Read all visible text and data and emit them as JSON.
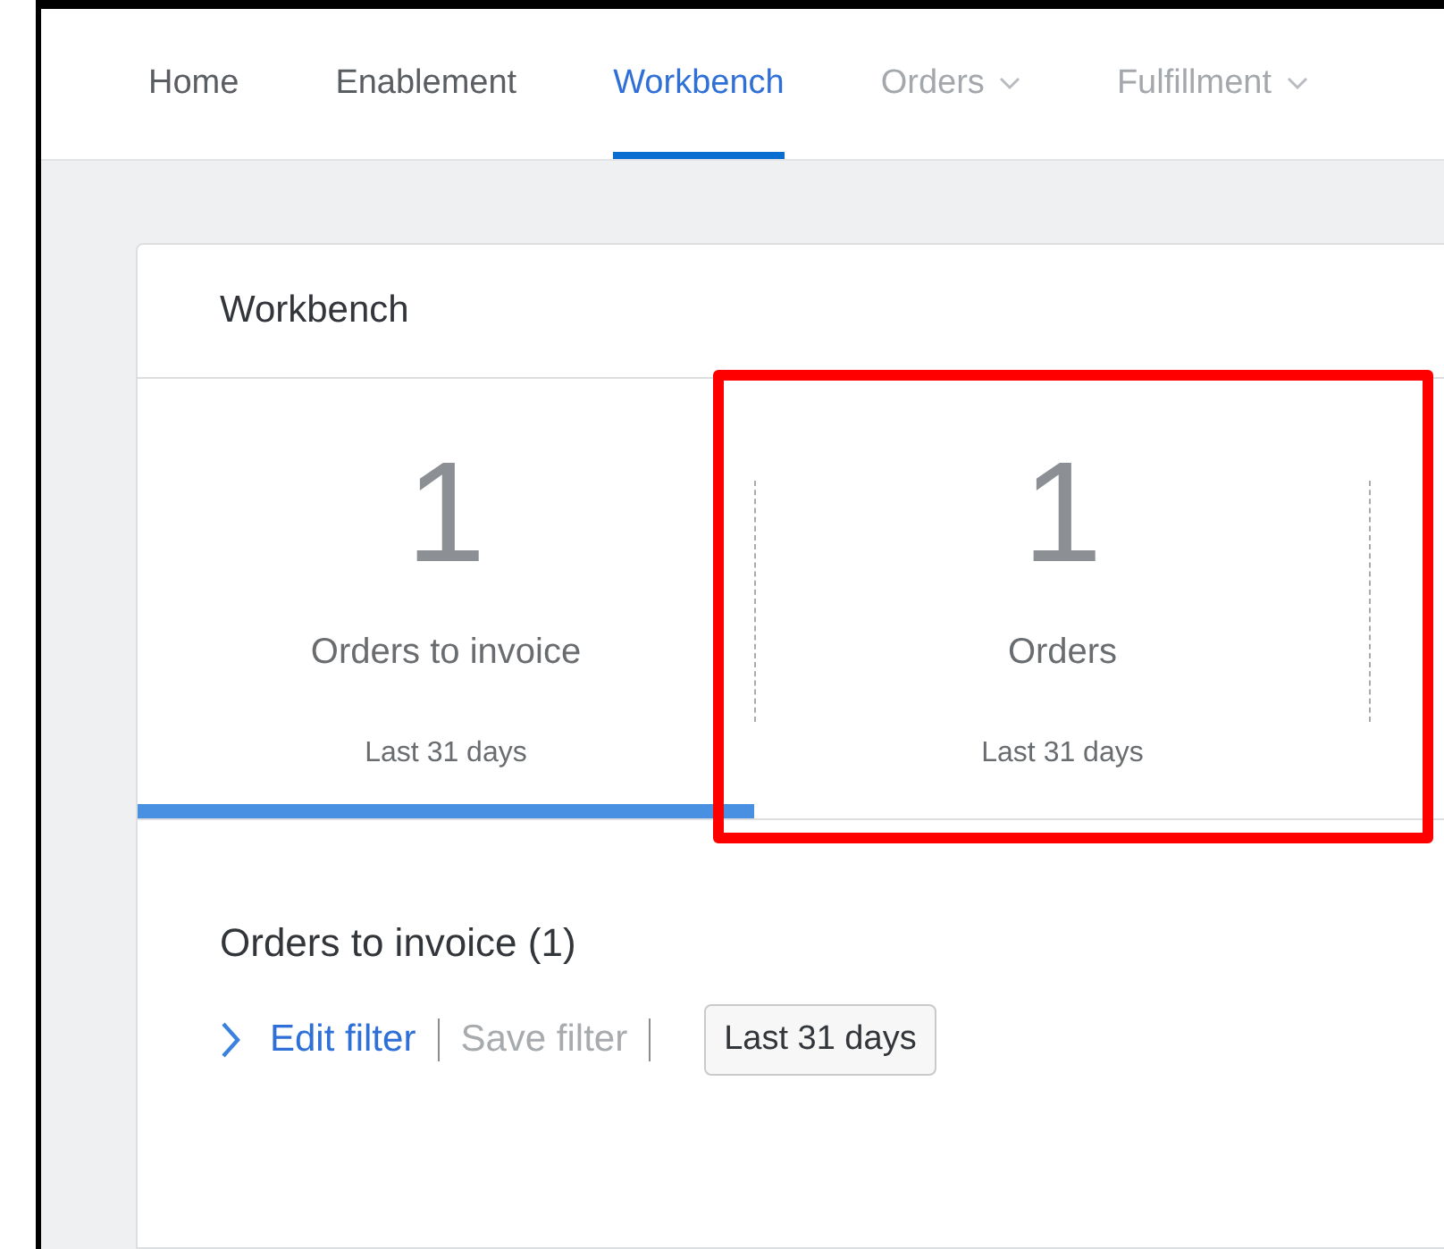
{
  "nav": [
    {
      "label": "Home",
      "selected": false,
      "disabled": false,
      "dropdown": false
    },
    {
      "label": "Enablement",
      "selected": false,
      "disabled": false,
      "dropdown": false
    },
    {
      "label": "Workbench",
      "selected": true,
      "disabled": false,
      "dropdown": false
    },
    {
      "label": "Orders",
      "selected": false,
      "disabled": true,
      "dropdown": true
    },
    {
      "label": "Fulfillment",
      "selected": false,
      "disabled": true,
      "dropdown": true
    }
  ],
  "card": {
    "title": "Workbench",
    "tiles": [
      {
        "count": "1",
        "label": "Orders to invoice",
        "period": "Last 31 days",
        "selected": true
      },
      {
        "count": "1",
        "label": "Orders",
        "period": "Last 31 days",
        "selected": false
      }
    ],
    "section_title": "Orders to invoice (1)",
    "filters": [
      {
        "label": "Edit filter",
        "disabled": false
      },
      {
        "label": "Save filter",
        "disabled": true
      }
    ],
    "date_range": "Last 31 days"
  }
}
